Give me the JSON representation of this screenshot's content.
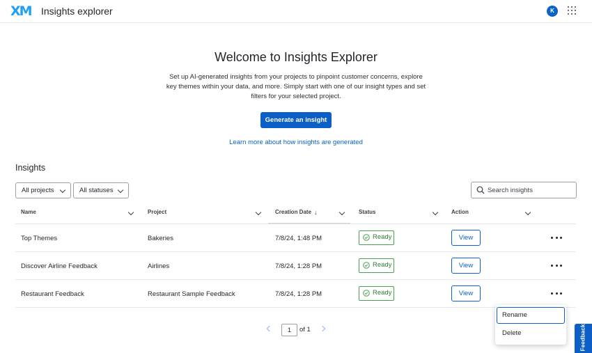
{
  "header": {
    "logo_text": "XM",
    "app_title": "Insights explorer",
    "avatar_initial": "K"
  },
  "hero": {
    "title": "Welcome to Insights Explorer",
    "description": "Set up AI-generated insights from your projects to pinpoint customer concerns, explore key themes within your data, and more. Simply start with one of our insight types and set filters for your selected project.",
    "primary_button": "Generate an insight",
    "learn_link": "Learn more about how insights are generated"
  },
  "insights": {
    "section_title": "Insights",
    "filters": {
      "projects": "All projects",
      "statuses": "All statuses"
    },
    "search": {
      "placeholder": "Search insights",
      "value": ""
    },
    "columns": {
      "name": "Name",
      "project": "Project",
      "creation_date": "Creation Date",
      "status": "Status",
      "action": "Action"
    },
    "sort_indicator": "↓",
    "rows": [
      {
        "name": "Top Themes",
        "project": "Bakeries",
        "date": "7/8/24, 1:48 PM",
        "status": "Ready",
        "action": "View"
      },
      {
        "name": "Discover Airline Feedback",
        "project": "Airlines",
        "date": "7/8/24, 1:28 PM",
        "status": "Ready",
        "action": "View"
      },
      {
        "name": "Restaurant Feedback",
        "project": "Restaurant Sample Feedback",
        "date": "7/8/24, 1:28 PM",
        "status": "Ready",
        "action": "View"
      }
    ]
  },
  "pagination": {
    "current_page": "1",
    "of_text": "of 1"
  },
  "context_menu": {
    "rename": "Rename",
    "delete": "Delete"
  },
  "feedback_tab": "Feedback",
  "colors": {
    "brand_blue": "#0b5fc7",
    "logo_blue": "#1da0f2",
    "status_green": "#47a04a"
  },
  "icons": [
    "xm-logo",
    "avatar",
    "apps-grid-icon",
    "search-icon",
    "chevron-down-icon",
    "sort-down-arrow-icon",
    "check-circle-icon",
    "more-horizontal-icon",
    "chevron-left-icon",
    "chevron-right-icon"
  ]
}
